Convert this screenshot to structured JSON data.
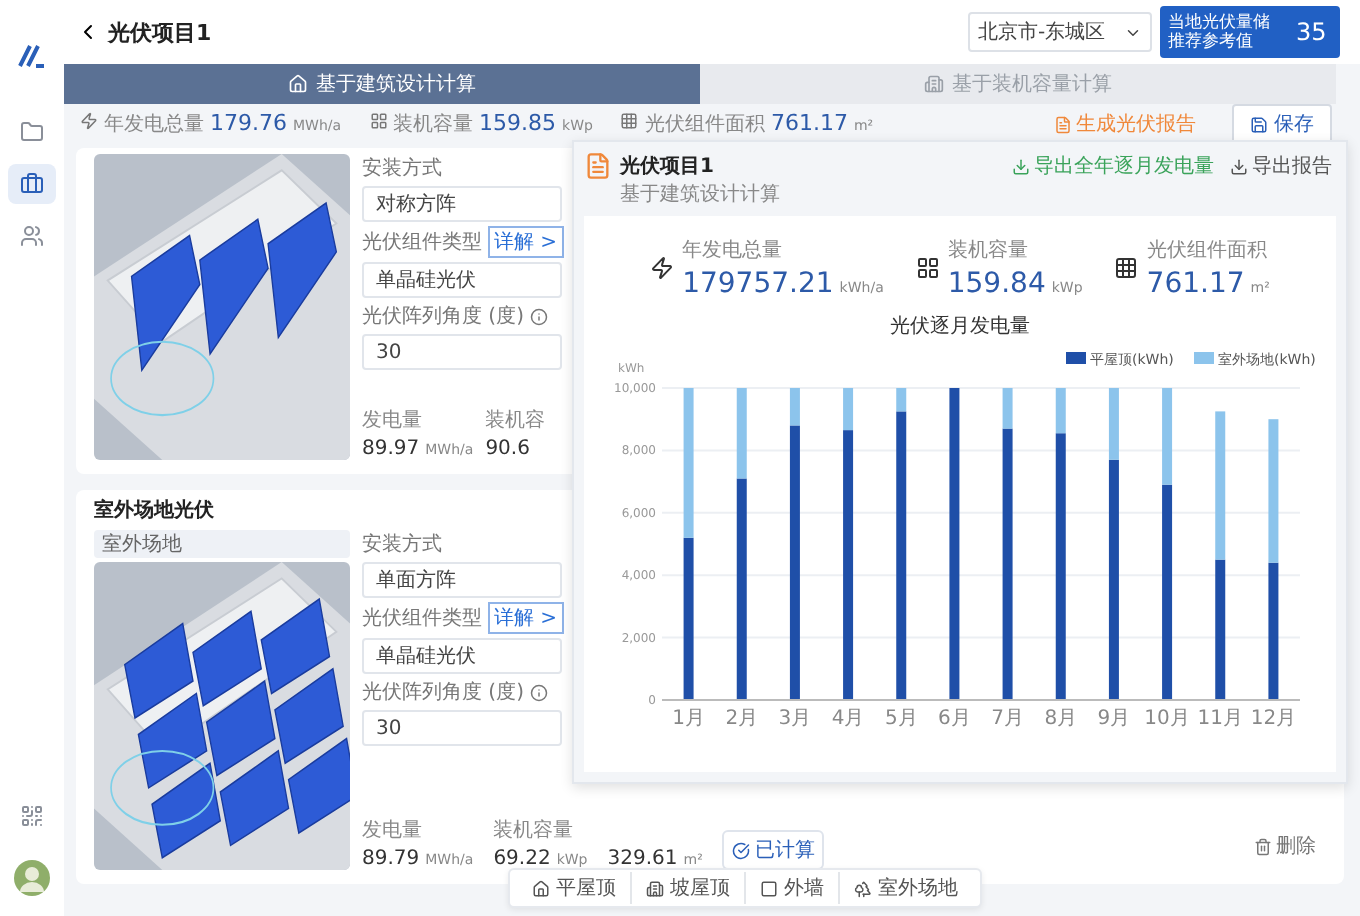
{
  "sidebar": {
    "items": [
      {
        "kind": "folder",
        "selected": false
      },
      {
        "kind": "briefcase",
        "selected": true
      },
      {
        "kind": "people",
        "selected": false
      },
      {
        "kind": "grid",
        "selected": false
      }
    ]
  },
  "header": {
    "title": "光伏项目1",
    "region": "北京市-东城区",
    "reference": {
      "label": "当地光伏量储推荐参考值",
      "value": "35"
    }
  },
  "tabs": [
    {
      "label": "基于建筑设计计算",
      "selected": true
    },
    {
      "label": "基于装机容量计算",
      "selected": false
    }
  ],
  "summary": [
    {
      "kind": "energy",
      "label": "年发电总量",
      "value": "179.76",
      "unit": "MWh/a"
    },
    {
      "kind": "capacity",
      "label": "装机容量",
      "value": "159.85",
      "unit": "kWp"
    },
    {
      "kind": "area",
      "label": "光伏组件面积",
      "value": "761.17",
      "unit": "m²"
    }
  ],
  "actions": {
    "report": "生成光伏报告",
    "save": "保存"
  },
  "cards": [
    {
      "fields": [
        {
          "label": "安装方式",
          "value": "对称方阵",
          "info": false
        },
        {
          "label": "光伏组件类型",
          "link": "详解 >",
          "value": "单晶硅光伏",
          "info": false
        },
        {
          "label": "光伏阵列角度 (度)",
          "value": "30",
          "info": true
        }
      ],
      "stats": [
        {
          "label": "发电量",
          "value": "89.97",
          "unit": "MWh/a"
        },
        {
          "label": "装机容",
          "value": "90.6"
        }
      ]
    },
    {
      "title": "室外场地光伏",
      "tag": "室外场地",
      "fields": [
        {
          "label": "安装方式",
          "value": "单面方阵",
          "info": false
        },
        {
          "label": "光伏组件类型",
          "link": "详解 >",
          "value": "单晶硅光伏",
          "info": false
        },
        {
          "label": "光伏阵列角度 (度)",
          "value": "30",
          "info": true
        }
      ],
      "stats": [
        {
          "label": "发电量",
          "value": "89.79",
          "unit": "MWh/a"
        },
        {
          "label": "装机容量",
          "value": "69.22",
          "unit": "kWp"
        },
        {
          "value": "329.61",
          "unit": "m²"
        }
      ],
      "status": "已计算",
      "delete": "删除"
    }
  ],
  "overlay": {
    "title": "光伏项目1",
    "subtitle": "基于建筑设计计算",
    "export_monthly": "导出全年逐月发电量",
    "export_report": "导出报告",
    "summary": [
      {
        "kind": "energy",
        "label": "年发电总量",
        "value": "179757.21",
        "unit": "kWh/a"
      },
      {
        "kind": "capacity",
        "label": "装机容量",
        "value": "159.84",
        "unit": "kWp"
      },
      {
        "kind": "area",
        "label": "光伏组件面积",
        "value": "761.17",
        "unit": "m²"
      }
    ],
    "chart_data": {
      "type": "bar",
      "stacked": true,
      "title": "光伏逐月发电量",
      "ylabel": "kWh",
      "categories": [
        "1月",
        "2月",
        "3月",
        "4月",
        "5月",
        "6月",
        "7月",
        "8月",
        "9月",
        "10月",
        "11月",
        "12月"
      ],
      "series": [
        {
          "name": "平屋顶(kWh)",
          "color": "#1f4fa8",
          "values": [
            5200,
            7100,
            8800,
            8650,
            9250,
            10000,
            8700,
            8550,
            7700,
            6900,
            4500,
            4400
          ]
        },
        {
          "name": "室外场地(kWh)",
          "color": "#8cc4ec",
          "values": [
            4800,
            2900,
            1200,
            1350,
            750,
            0,
            1300,
            1450,
            2300,
            3100,
            4750,
            4600
          ]
        }
      ],
      "ylim": [
        0,
        10000
      ],
      "grid": true,
      "legend": true,
      "yticks": [
        {
          "value": 0,
          "label": "0"
        },
        {
          "value": 2000,
          "label": "2,000"
        },
        {
          "value": 4000,
          "label": "4,000"
        },
        {
          "value": 6000,
          "label": "6,000"
        },
        {
          "value": 8000,
          "label": "8,000"
        },
        {
          "value": 10000,
          "label": "10,000"
        }
      ]
    }
  },
  "add_bar": [
    {
      "kind": "flat",
      "label": "平屋顶"
    },
    {
      "kind": "sloped",
      "label": "坡屋顶"
    },
    {
      "kind": "wall",
      "label": "外墙"
    },
    {
      "kind": "ground",
      "label": "室外场地"
    }
  ]
}
